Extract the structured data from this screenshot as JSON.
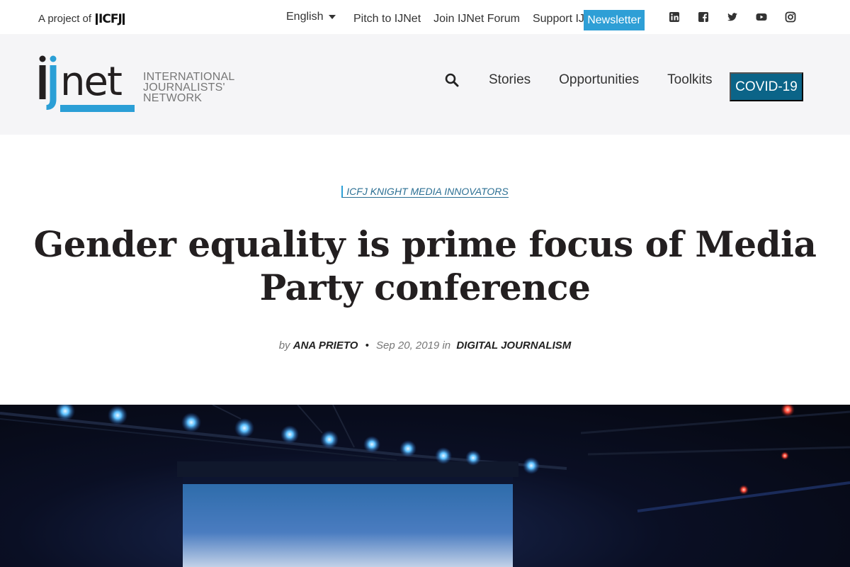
{
  "topbar": {
    "project_prefix": "A project of",
    "project_logo": "ICFJ",
    "language": "English",
    "links": [
      "Pitch to IJNet",
      "Join IJNet Forum",
      "Support IJNet"
    ],
    "newsletter": "Newsletter",
    "socials": [
      "linkedin-icon",
      "facebook-icon",
      "twitter-icon",
      "youtube-icon",
      "instagram-icon"
    ]
  },
  "header": {
    "logo_tagline": [
      "INTERNATIONAL",
      "JOURNALISTS'",
      "NETWORK"
    ],
    "nav": [
      "Stories",
      "Opportunities",
      "Toolkits"
    ],
    "covid": "COVID-19"
  },
  "article": {
    "category": "ICFJ KNIGHT MEDIA INNOVATORS",
    "title": "Gender equality is prime focus of Media Party conference",
    "by": "by",
    "author": "ANA PRIETO",
    "date": "Sep 20, 2019",
    "in": "in",
    "section": "DIGITAL JOURNALISM"
  },
  "colors": {
    "newsletter_bg": "#2e9fd6",
    "covid_bg": "#0b6488",
    "logo_blue": "#2b9fd6",
    "header_bg": "#f5f5f7"
  }
}
